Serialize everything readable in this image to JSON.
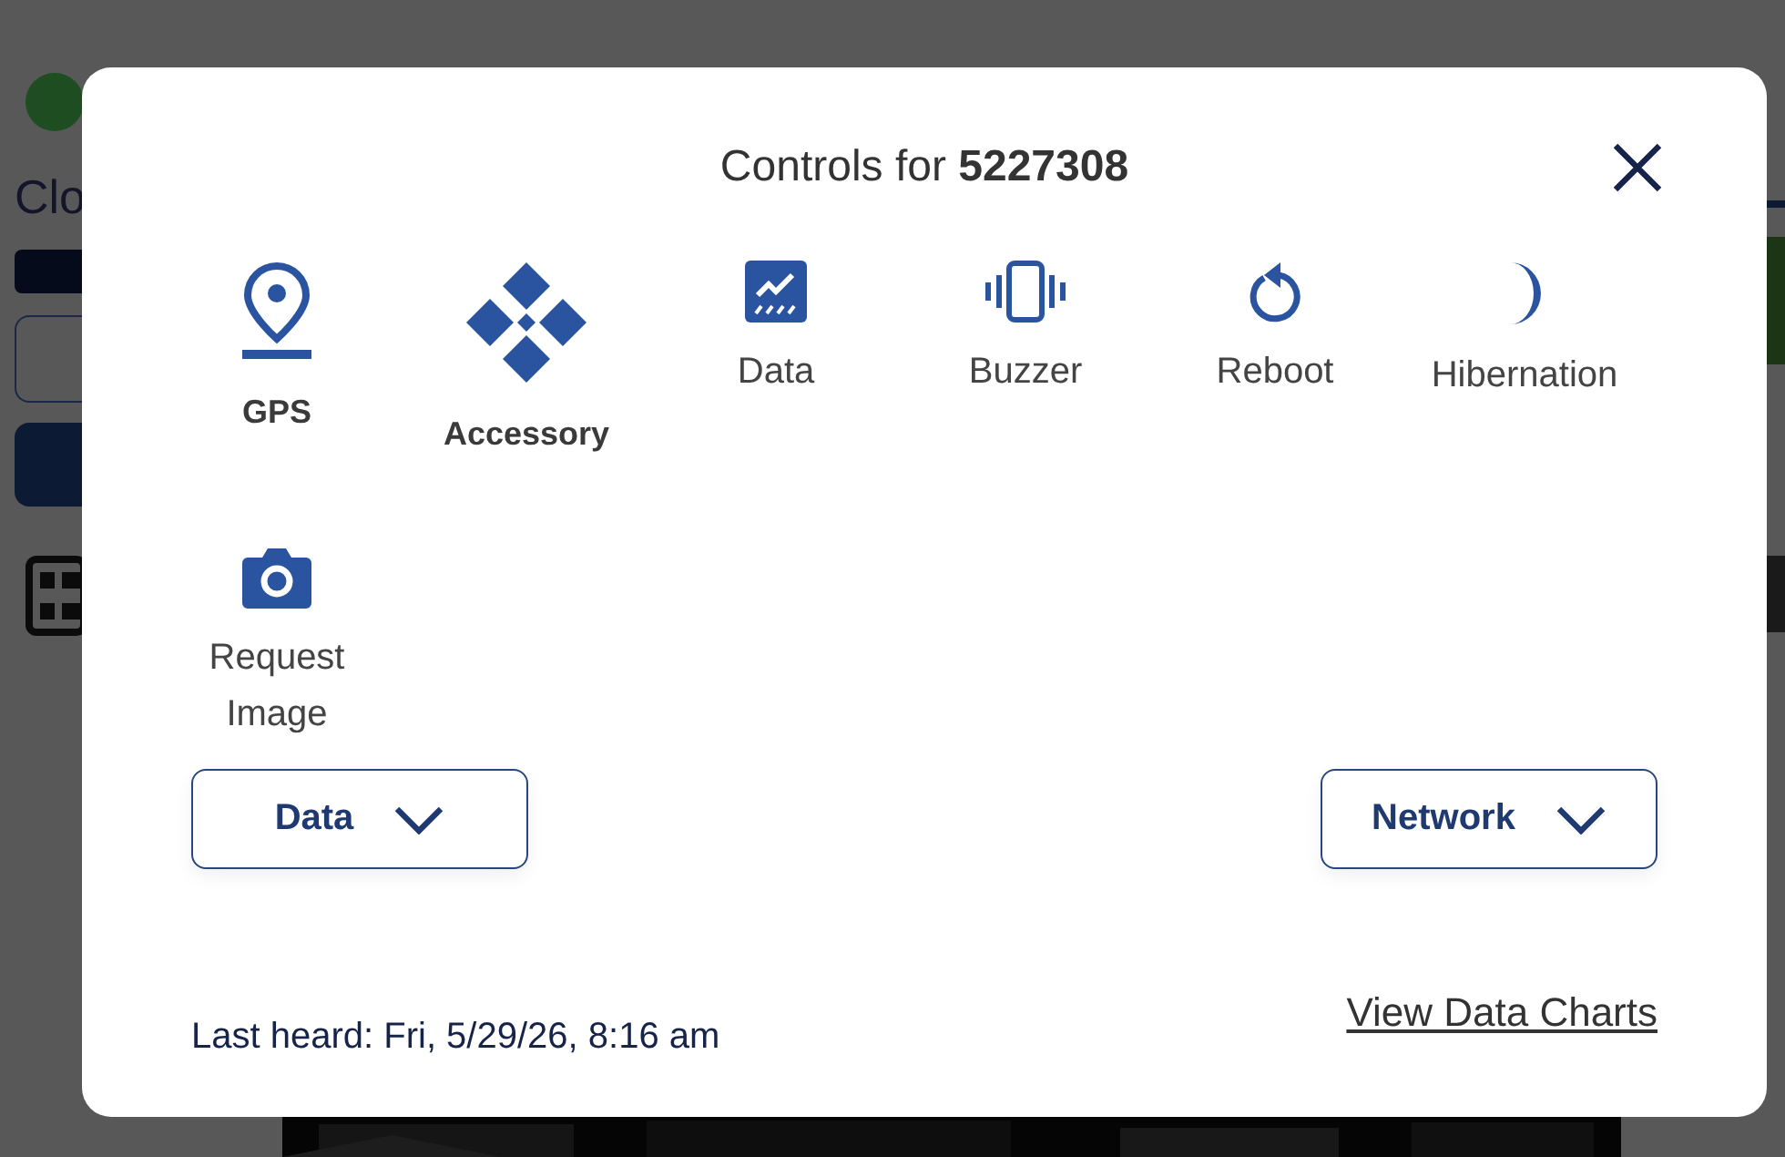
{
  "background": {
    "partial_text": "Clo"
  },
  "dialog": {
    "title": "Controls for **5227308**",
    "controls": [
      {
        "kind": "gps",
        "label": "GPS",
        "active": true
      },
      {
        "kind": "accessory",
        "label": "Accessory",
        "active": true
      },
      {
        "kind": "data",
        "label": "Data",
        "active": false
      },
      {
        "kind": "buzzer",
        "label": "Buzzer",
        "active": false
      },
      {
        "kind": "reboot",
        "label": "Reboot",
        "active": false
      },
      {
        "kind": "hibernation",
        "label": "Hibernation",
        "active": false
      },
      {
        "kind": "camera",
        "label": "Request Image",
        "active": false
      }
    ],
    "dropdowns": [
      {
        "label": "Data"
      },
      {
        "label": "Network"
      }
    ],
    "last_heard": "Last heard: Fri, 5/29/26, 8:16 am",
    "link": "View Data Charts"
  }
}
